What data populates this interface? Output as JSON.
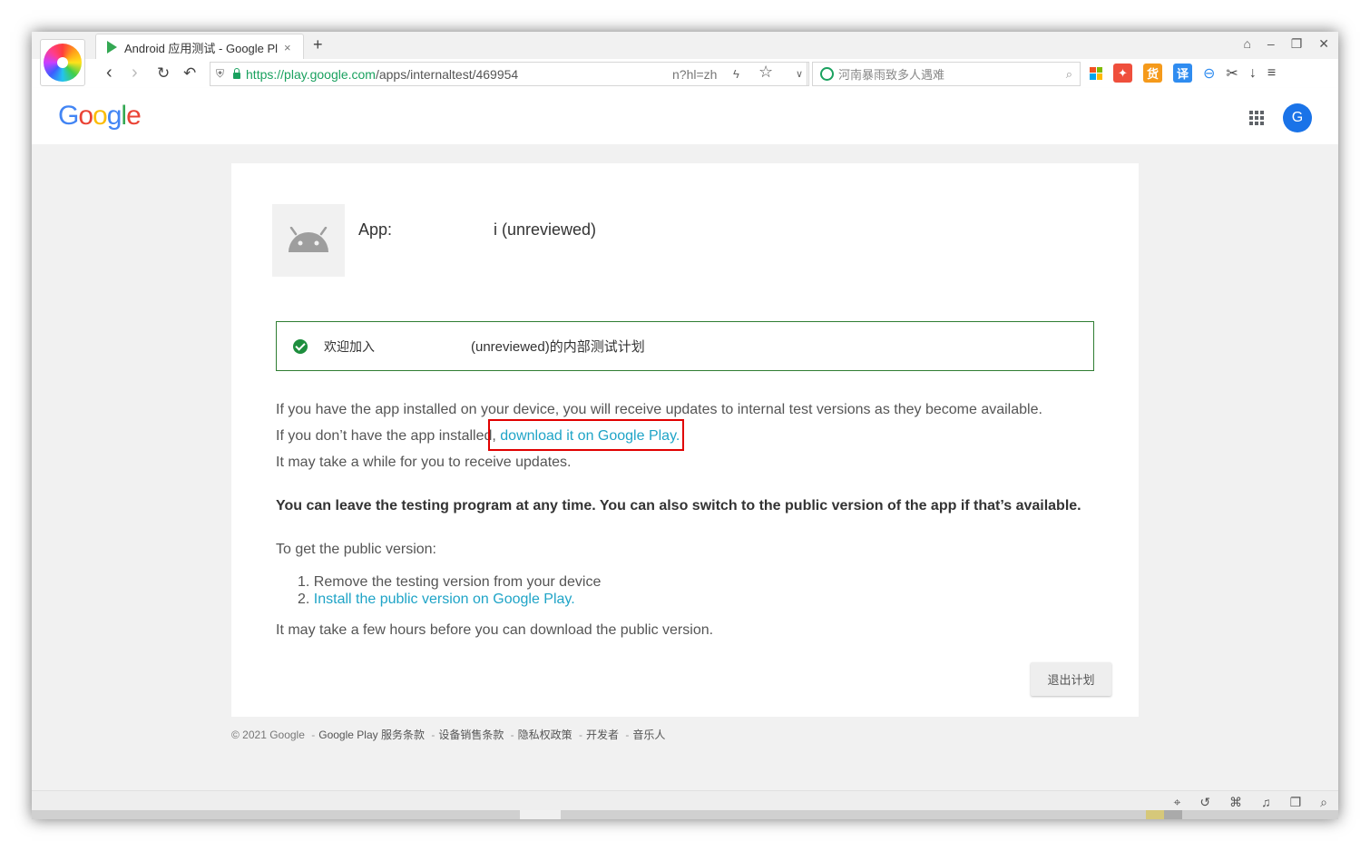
{
  "browser": {
    "tab_title": "Android 应用测试 - Google Pl",
    "tab_close": "×",
    "new_tab": "+",
    "address": {
      "scheme": "https://",
      "host": "play.google.com",
      "path": "/apps/internaltest/469954",
      "query": "n?hl=zh"
    },
    "search_placeholder": "河南暴雨致多人遇难",
    "window_controls": [
      "⌂",
      "–",
      "❐",
      "✕"
    ]
  },
  "google_header": {
    "logo": [
      "G",
      "o",
      "o",
      "g",
      "l",
      "e"
    ],
    "avatar_letter": "G"
  },
  "card": {
    "app_label": "App:",
    "app_name": "i (unreviewed)",
    "notice_prefix": "欢迎加入",
    "notice_suffix": "(unreviewed)的内部测试计划",
    "line1": "If you have the app installed on your device, you will receive updates to internal test versions as they become available.",
    "line2_prefix": "If you don’t have the app installed, ",
    "line2_link": "download it on Google Play",
    "line2_suffix": ".",
    "line3": "It may take a while for you to receive updates.",
    "bold_line": "You can leave the testing program at any time. You can also switch to the public version of the app if that’s available.",
    "public_heading": "To get the public version:",
    "step1": "1. Remove the testing version from your device",
    "step2_num": "2. ",
    "step2_link": "Install the public version on Google Play.",
    "final_line": "It may take a few hours before you can download the public version.",
    "leave_button": "退出计划"
  },
  "footer": {
    "copyright": "© 2021 Google",
    "links": [
      "Google Play 服务条款",
      "设备销售条款",
      "隐私权政策",
      "开发者",
      "音乐人"
    ]
  },
  "icons": {
    "toolbar": [
      "ms-grid-icon",
      "game-icon",
      "shopping-icon",
      "translate-icon",
      "zoom-icon",
      "scissors-icon",
      "download-icon",
      "menu-icon"
    ],
    "statusbar": [
      "pin-icon",
      "refresh-icon",
      "trash-icon",
      "volume-icon",
      "window-icon",
      "search-icon"
    ]
  },
  "colors": {
    "link": "#1fa4c7",
    "notice_border": "#2f7d32",
    "highlight": "#e00000",
    "avatar": "#1a73e8"
  }
}
